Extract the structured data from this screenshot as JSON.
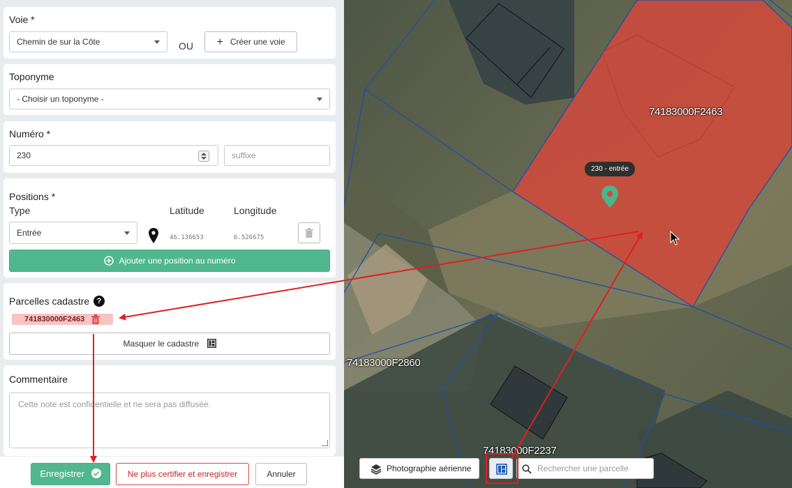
{
  "voie": {
    "title": "Voie *",
    "selected": "Chemin de sur la Côte",
    "or_label": "OU",
    "create_label": "Créer une voie"
  },
  "toponyme": {
    "title": "Toponyme",
    "selected": "- Choisir un toponyme -"
  },
  "numero": {
    "title": "Numéro *",
    "value": "230",
    "suffix_placeholder": "suffixe"
  },
  "positions": {
    "title": "Positions *",
    "col_type": "Type",
    "col_lat": "Latitude",
    "col_lng": "Longitude",
    "type_selected": "Entrée",
    "latitude": "46.136653",
    "longitude": "6.526675",
    "add_label": "Ajouter une position au numéro"
  },
  "parcelles": {
    "title": "Parcelles cadastre",
    "help": "?",
    "tag": "741830000F2463",
    "toggle_label": "Masquer le cadastre"
  },
  "commentaire": {
    "title": "Commentaire",
    "placeholder": "Cette note est confidentielle et ne sera pas diffusée."
  },
  "actions": {
    "save": "Enregistrer",
    "uncertify": "Ne plus certifier et enregistrer",
    "cancel": "Annuler"
  },
  "map": {
    "parcel_label_1": "74183000F2463",
    "parcel_label_2": "74183000F2860",
    "parcel_label_3": "74183000F2237",
    "marker_tooltip": "230 - entrée",
    "layer_button": "Photographie aérienne",
    "search_placeholder": "Rechercher une parcelle"
  },
  "colors": {
    "accent_green": "#51b78e",
    "danger_red": "#e04545",
    "parcel_fill": "#cf4a3c",
    "parcel_border": "#1f4fa8",
    "annotation_red": "#e01f1f"
  }
}
